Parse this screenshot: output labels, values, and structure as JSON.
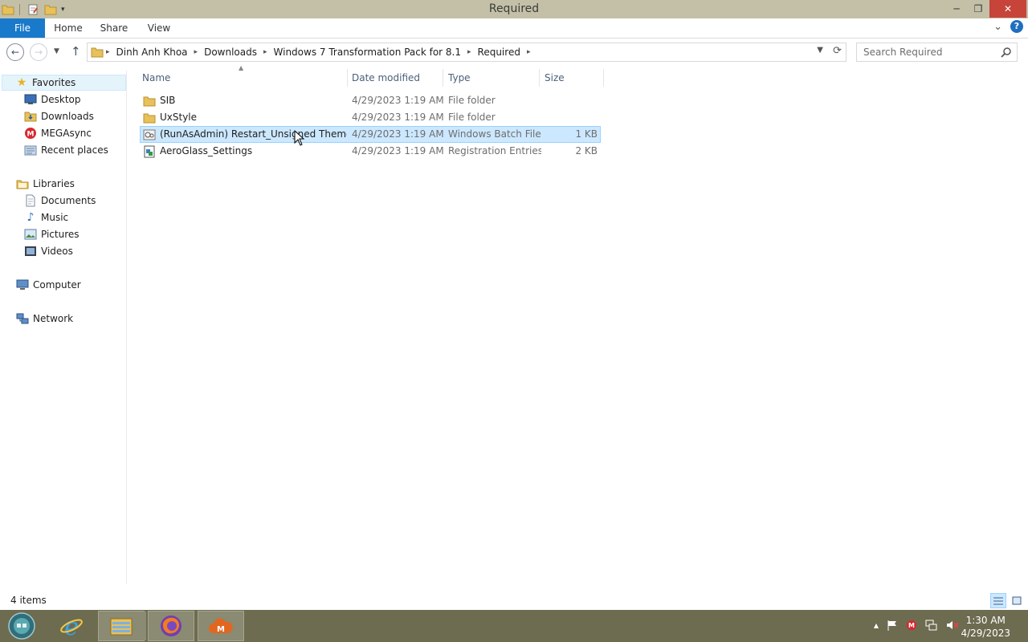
{
  "window": {
    "title": "Required",
    "minimize": "─",
    "restore": "❐",
    "close": "✕"
  },
  "ribbon": {
    "tabs": [
      "File",
      "Home",
      "Share",
      "View"
    ],
    "expand": "⌄",
    "help": "?"
  },
  "address": {
    "crumbs": [
      "Dinh Anh Khoa",
      "Downloads",
      "Windows 7 Transformation Pack for 8.1",
      "Required"
    ],
    "search_placeholder": "Search Required"
  },
  "nav_pane": {
    "favorites": {
      "label": "Favorites",
      "items": [
        "Desktop",
        "Downloads",
        "MEGAsync",
        "Recent places"
      ]
    },
    "libraries": {
      "label": "Libraries",
      "items": [
        "Documents",
        "Music",
        "Pictures",
        "Videos"
      ]
    },
    "computer": "Computer",
    "network": "Network"
  },
  "columns": {
    "name": "Name",
    "date": "Date modified",
    "type": "Type",
    "size": "Size"
  },
  "files": [
    {
      "name": "SIB",
      "date": "4/29/2023 1:19 AM",
      "type": "File folder",
      "size": "",
      "icon": "folder-icon"
    },
    {
      "name": "UxStyle",
      "date": "4/29/2023 1:19 AM",
      "type": "File folder",
      "size": "",
      "icon": "folder-icon"
    },
    {
      "name": "(RunAsAdmin) Restart_Unsigned Themes...",
      "date": "4/29/2023 1:19 AM",
      "type": "Windows Batch File",
      "size": "1 KB",
      "icon": "batch-file-icon",
      "selected": true
    },
    {
      "name": "AeroGlass_Settings",
      "date": "4/29/2023 1:19 AM",
      "type": "Registration Entries",
      "size": "2 KB",
      "icon": "registry-file-icon"
    }
  ],
  "status": {
    "item_count": "4 items"
  },
  "taskbar": {
    "clock_time": "1:30 AM",
    "clock_date": "4/29/2023",
    "tray_chevron": "▲",
    "apps": [
      "start-orb-icon",
      "internet-explorer-icon",
      "file-explorer-icon",
      "firefox-icon",
      "megasync-icon"
    ]
  },
  "colors": {
    "titlebar": "#c3c0a7",
    "file_tab": "#1979ca",
    "close_button": "#c7443b",
    "selection": "#cce8ff",
    "taskbar": "#6d6b50"
  }
}
